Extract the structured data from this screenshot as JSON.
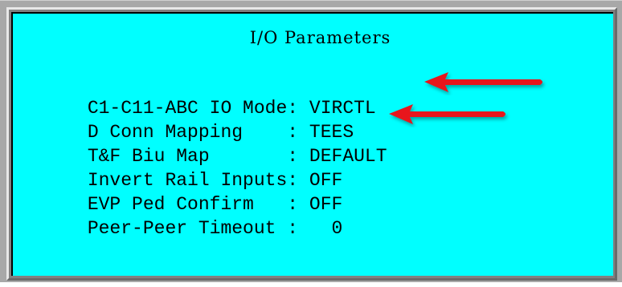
{
  "window": {
    "title": "I/O Parameters"
  },
  "parameters": [
    {
      "label": "C1-C11-ABC IO Mode",
      "separator": ":",
      "value": "VIRCTL"
    },
    {
      "label": "D Conn Mapping    ",
      "separator": ":",
      "value": "TEES"
    },
    {
      "label": "T&F Biu Map       ",
      "separator": ":",
      "value": "DEFAULT"
    },
    {
      "label": "Invert Rail Inputs",
      "separator": ":",
      "value": "OFF"
    },
    {
      "label": "EVP Ped Confirm   ",
      "separator": ":",
      "value": "OFF"
    },
    {
      "label": "Peer-Peer Timeout ",
      "separator": ":",
      "value": "  0"
    }
  ],
  "annotations": {
    "arrow_color": "#e8141c",
    "arrow_targets": [
      "VIRCTL",
      "TEES"
    ]
  },
  "colors": {
    "screen_background": "#00ffff",
    "text": "#000000",
    "frame": "#a8a8a8"
  }
}
